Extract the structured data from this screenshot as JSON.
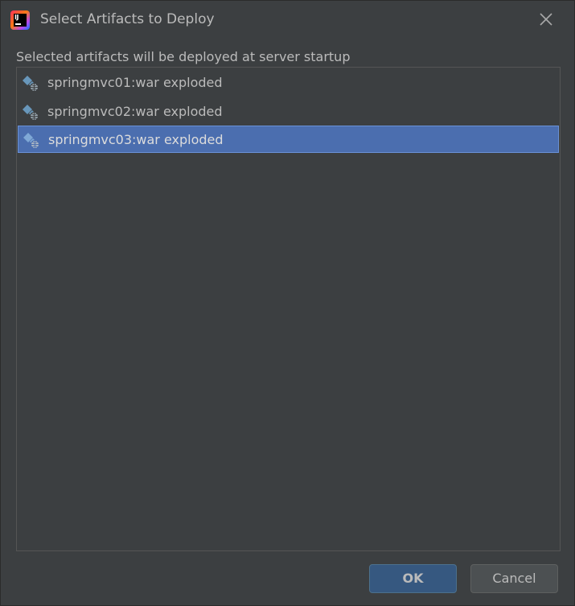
{
  "window": {
    "title": "Select Artifacts to Deploy",
    "app_icon": "intellij-idea-icon",
    "close_icon": "close-icon"
  },
  "description": "Selected artifacts will be deployed at server startup",
  "artifacts": [
    {
      "label": "springmvc01:war exploded",
      "icon": "web-artifact-icon",
      "selected": false
    },
    {
      "label": "springmvc02:war exploded",
      "icon": "web-artifact-icon",
      "selected": false
    },
    {
      "label": "springmvc03:war exploded",
      "icon": "web-artifact-icon",
      "selected": true
    }
  ],
  "buttons": {
    "ok_label": "OK",
    "cancel_label": "Cancel"
  },
  "colors": {
    "background": "#3c3f41",
    "selection": "#4b6eaf",
    "text": "#bbbbbb",
    "ok_button": "#365880",
    "cancel_button": "#4c5052"
  }
}
